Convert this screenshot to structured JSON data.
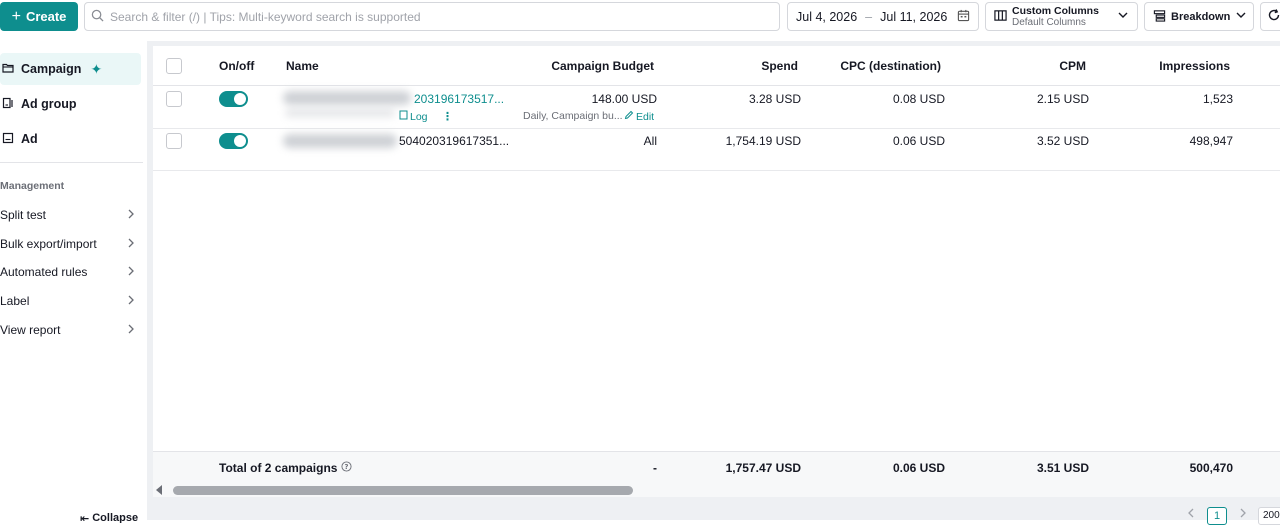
{
  "toolbar": {
    "create_label": "Create",
    "search_placeholder": "Search & filter (/) | Tips: Multi-keyword search is supported",
    "date_start": "Jul 4, 2026",
    "date_sep": "–",
    "date_end": "Jul 11, 2026",
    "columns_title": "Custom Columns",
    "columns_sub": "Default Columns",
    "breakdown_label": "Breakdown"
  },
  "sidebar": {
    "levels": [
      {
        "label": "Campaign",
        "icon": "folder-icon"
      },
      {
        "label": "Ad group",
        "icon": "ad-group-icon"
      },
      {
        "label": "Ad",
        "icon": "ad-icon"
      }
    ],
    "section_title": "Management",
    "management": [
      {
        "label": "Split test"
      },
      {
        "label": "Bulk export/import"
      },
      {
        "label": "Automated rules"
      },
      {
        "label": "Label"
      },
      {
        "label": "View report"
      }
    ],
    "collapse_label": "Collapse"
  },
  "table": {
    "headers": {
      "onoff": "On/off",
      "name": "Name",
      "budget": "Campaign Budget",
      "spend": "Spend",
      "cpc": "CPC (destination)",
      "cpm": "CPM",
      "impressions": "Impressions"
    },
    "rows": [
      {
        "name_suffix": "203196173517...",
        "budget": "148.00 USD",
        "budget_sub": "Daily, Campaign bu...",
        "edit_label": "Edit",
        "log_label": "Log",
        "spend": "3.28 USD",
        "cpc": "0.08 USD",
        "cpm": "2.15 USD",
        "impressions": "1,523"
      },
      {
        "name_suffix": "504020319617351...",
        "budget": "All",
        "spend": "1,754.19 USD",
        "cpc": "0.06 USD",
        "cpm": "3.52 USD",
        "impressions": "498,947"
      }
    ],
    "total": {
      "label": "Total of 2 campaigns",
      "budget": "-",
      "spend": "1,757.47 USD",
      "cpc": "0.06 USD",
      "cpm": "3.51 USD",
      "impressions": "500,470"
    }
  },
  "pagination": {
    "current_page": "1",
    "page_size": "200"
  },
  "colors": {
    "accent": "#0e8e8e",
    "active_bg": "#eaf7f7"
  }
}
